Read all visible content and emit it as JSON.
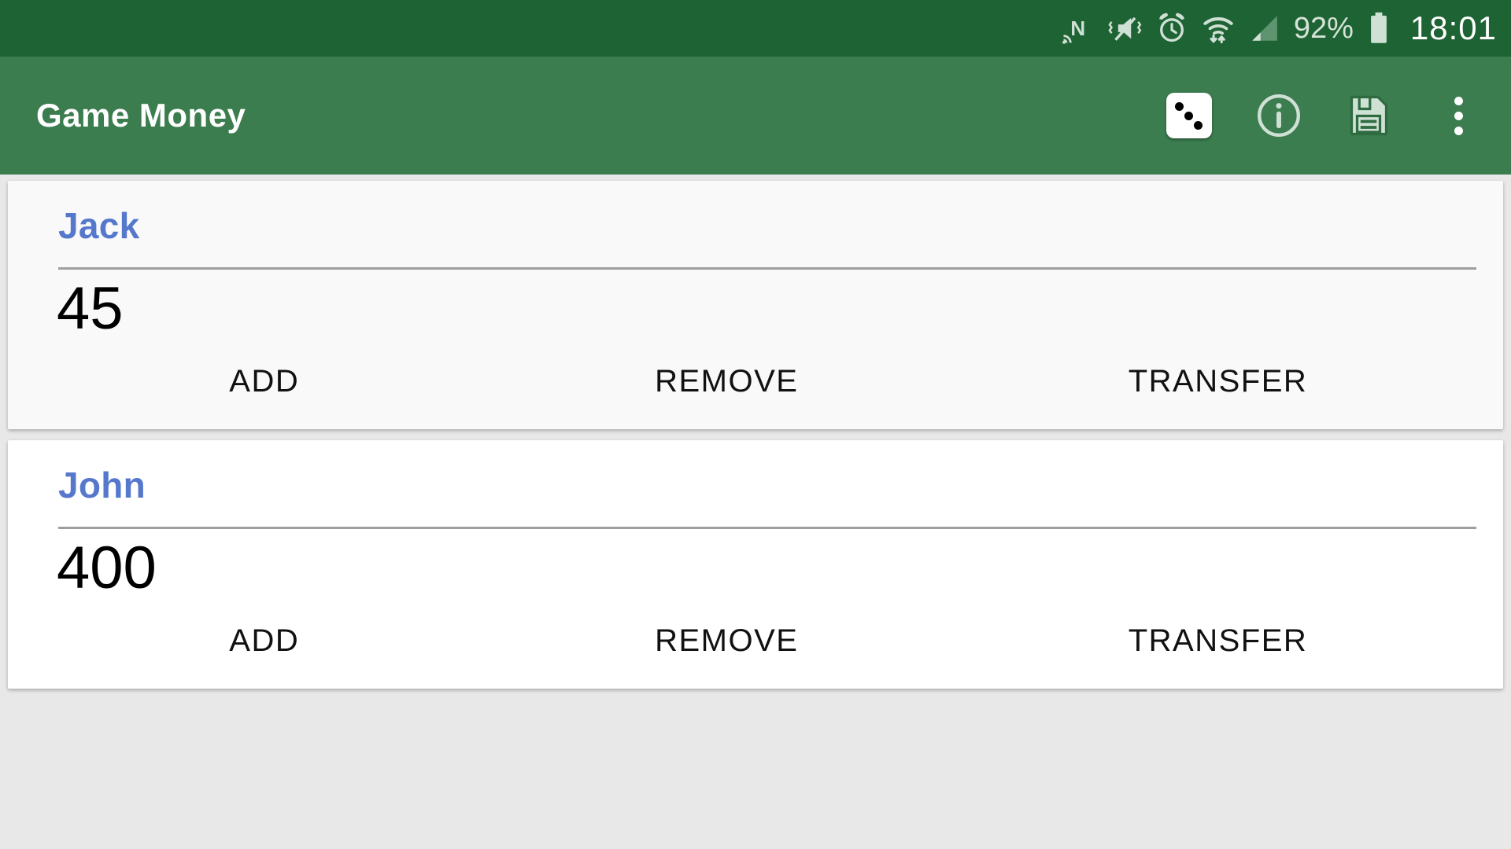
{
  "status_bar": {
    "icons": [
      {
        "name": "nfc-icon",
        "label": "N"
      },
      {
        "name": "vibrate-mute-icon",
        "label": "mute"
      },
      {
        "name": "alarm-clock-icon",
        "label": "alarm"
      },
      {
        "name": "wifi-icon",
        "label": "wifi"
      },
      {
        "name": "cellular-signal-icon",
        "label": "signal"
      }
    ],
    "battery_percent": "92%",
    "clock": "18:01",
    "background_color": "#1e6334",
    "icon_color": "#cfe0d4"
  },
  "app_bar": {
    "title": "Game Money",
    "background_color": "#3b7d4f",
    "title_color": "#ffffff",
    "actions": [
      {
        "name": "dice-icon",
        "label": "Dice"
      },
      {
        "name": "info-icon",
        "label": "Info"
      },
      {
        "name": "save-icon",
        "label": "Save"
      },
      {
        "name": "overflow-menu-icon",
        "label": "More options"
      }
    ]
  },
  "main": {
    "accent_name_color": "#5578cc",
    "players": [
      {
        "name": "Jack",
        "balance": "45",
        "card_style": "variant-grey",
        "actions": {
          "add": "ADD",
          "remove": "REMOVE",
          "transfer": "TRANSFER"
        }
      },
      {
        "name": "John",
        "balance": "400",
        "card_style": "variant-white",
        "actions": {
          "add": "ADD",
          "remove": "REMOVE",
          "transfer": "TRANSFER"
        }
      }
    ]
  }
}
